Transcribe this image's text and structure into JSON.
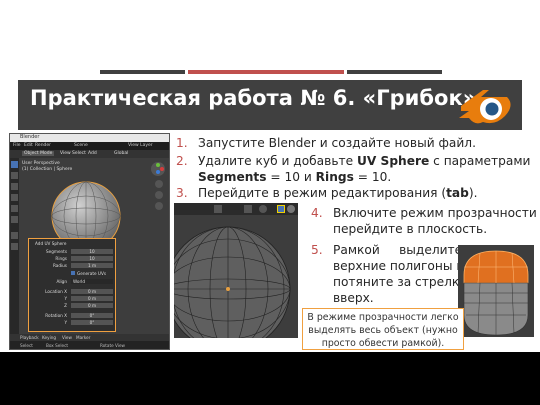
{
  "title": "Практическая работа № 6. «Грибок»",
  "colors": {
    "title_bg": "#404040",
    "accent": "#c0504d",
    "highlight": "#f0a040",
    "sphere": "#e07020"
  },
  "steps": [
    {
      "num": "1.",
      "text": "Запустите Blender и создайте новый файл."
    },
    {
      "num": "2.",
      "text_before": "Удалите куб и добавьте ",
      "bold1": "UV Sphere",
      "text_mid": " с параметрами",
      "line2_bold_a": "Segments",
      "line2_mid": " = 10 и ",
      "line2_bold_b": "Rings",
      "line2_end": " = 10."
    },
    {
      "num": "3.",
      "text_before": "Перейдите в режим редактирования (",
      "bold1": "tab",
      "text_end": ")."
    },
    {
      "num": "4.",
      "line1": "Включите режим прозрачности и",
      "line2": "перейдите в плоскость."
    },
    {
      "num": "5.",
      "line1": "Рамкой     выделите",
      "line2": "верхние полигоны и",
      "line3": "потяните за стрелку",
      "line4": "вверх."
    }
  ],
  "note": {
    "line1": "В режиме прозрачности легко",
    "line2": "выделять весь объект (нужно",
    "line3": "просто обвести рамкой)."
  },
  "blender": {
    "app": "Blender",
    "menu": [
      "File",
      "Edit",
      "Render",
      "Window",
      "Help"
    ],
    "scene": "Scene",
    "view_layer": "View Layer",
    "mode": "Object Mode",
    "view": "View",
    "select": "Select",
    "add": "Add",
    "object": "Object",
    "global": "Global",
    "perspective": "User Perspective",
    "collection": "(1) Collection | Sphere",
    "panel_title": "Add UV Sphere",
    "fields": [
      {
        "label": "Segments",
        "value": "10"
      },
      {
        "label": "Rings",
        "value": "10"
      },
      {
        "label": "Radius",
        "value": "1 m"
      }
    ],
    "checkbox": "Generate UVs",
    "align_label": "Align",
    "align_value": "World",
    "location": [
      {
        "label": "Location X",
        "value": "0 m"
      },
      {
        "label": "Y",
        "value": "0 m"
      },
      {
        "label": "Z",
        "value": "0 m"
      }
    ],
    "rotation": [
      {
        "label": "Rotation X",
        "value": "0°"
      },
      {
        "label": "Y",
        "value": "0°"
      }
    ],
    "timeline": [
      "Playback",
      "Keying",
      "View",
      "Marker"
    ],
    "status": [
      "Select",
      "Box Select",
      "Rotate View"
    ]
  }
}
